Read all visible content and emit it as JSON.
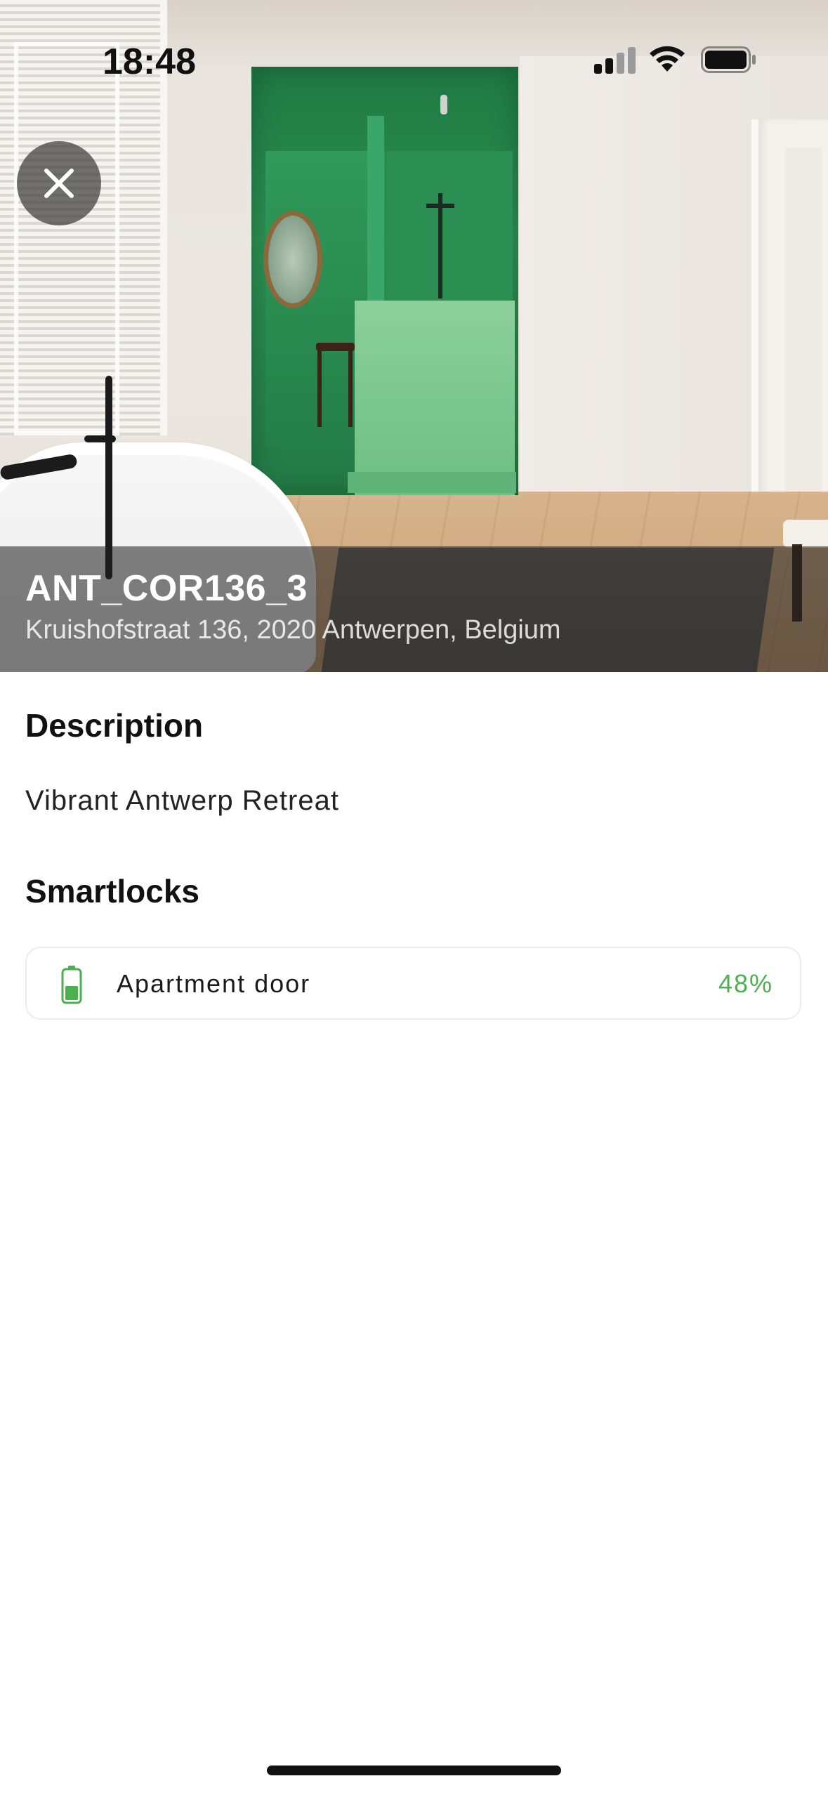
{
  "status_bar": {
    "time": "18:48",
    "icons": [
      "cellular-signal-icon",
      "wifi-icon",
      "battery-icon"
    ]
  },
  "hero": {
    "title": "ANT_COR136_3",
    "address": "Kruishofstraat 136, 2020 Antwerpen, Belgium",
    "close_icon": "close-icon"
  },
  "description": {
    "heading": "Description",
    "text": "Vibrant Antwerp Retreat"
  },
  "smartlocks": {
    "heading": "Smartlocks",
    "items": [
      {
        "name": "Apartment door",
        "battery_percent": "48%",
        "battery_level": 0.48,
        "icon": "battery-icon",
        "color": "#4caf50"
      }
    ]
  }
}
